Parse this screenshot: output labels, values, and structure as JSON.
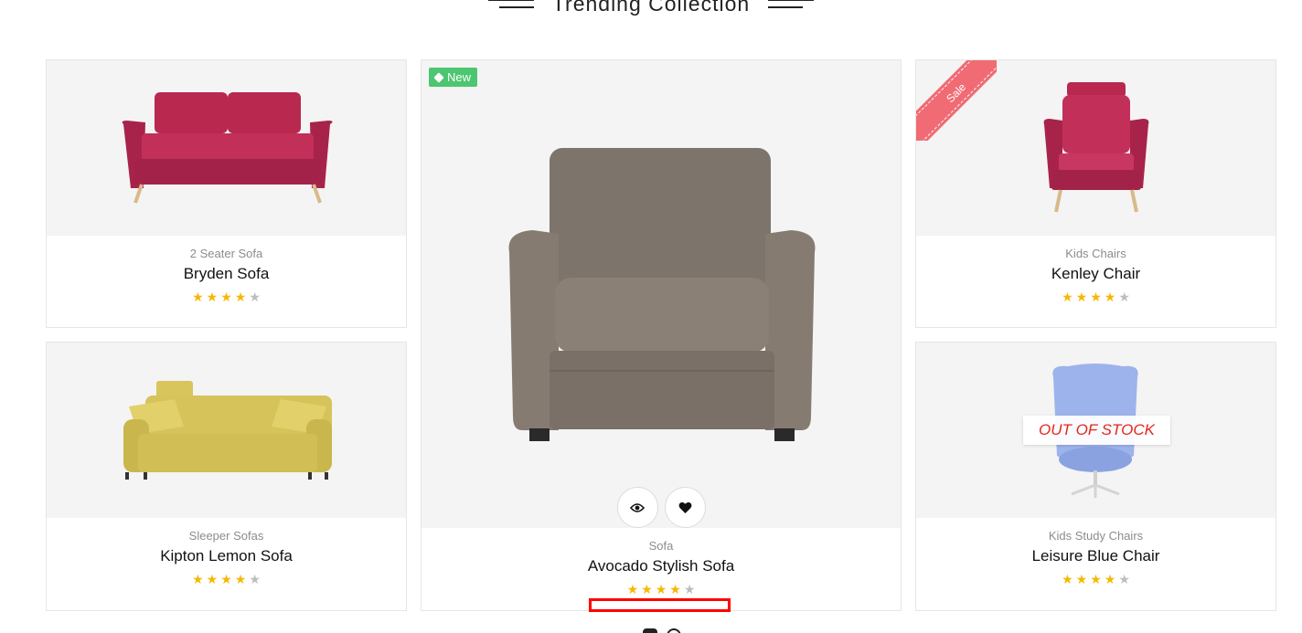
{
  "section": {
    "title": "Trending Collection"
  },
  "products": [
    {
      "category": "2 Seater Sofa",
      "name": "Bryden Sofa",
      "rating": 4,
      "max_rating": 5
    },
    {
      "category": "Sleeper Sofas",
      "name": "Kipton Lemon Sofa",
      "rating": 4,
      "max_rating": 5
    },
    {
      "category": "Sofa",
      "name": "Avocado Stylish Sofa",
      "rating": 4,
      "max_rating": 5,
      "badge": "New",
      "badge_icon": "tag-icon",
      "actions": [
        "eye-icon",
        "heart-icon"
      ]
    },
    {
      "category": "Kids Chairs",
      "name": "Kenley Chair",
      "rating": 4,
      "max_rating": 5,
      "ribbon": "Sale"
    },
    {
      "category": "Kids Study Chairs",
      "name": "Leisure Blue Chair",
      "rating": 4,
      "max_rating": 5,
      "overlay": "OUT OF STOCK"
    }
  ],
  "colors": {
    "new_badge": "#4cc670",
    "sale_ribbon": "#f06b73",
    "star": "#f6b800",
    "out_of_stock": "#e2271b",
    "highlight_box": "#ff0000"
  },
  "pagination": {
    "active": 1,
    "total": 2
  }
}
